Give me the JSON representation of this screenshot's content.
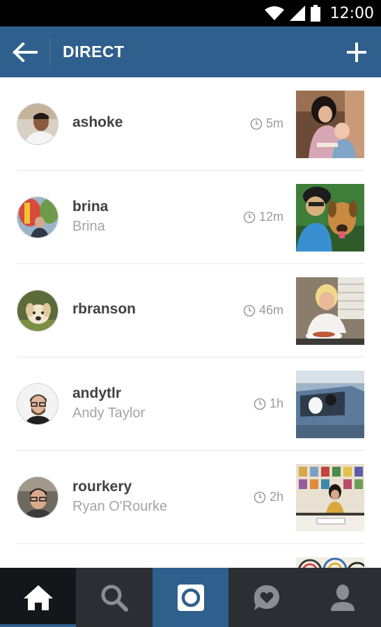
{
  "status_bar": {
    "time": "12:00"
  },
  "header": {
    "title": "DIRECT"
  },
  "threads": [
    {
      "username": "ashoke",
      "fullname": "",
      "time": "5m"
    },
    {
      "username": "brina",
      "fullname": "Brina",
      "time": "12m"
    },
    {
      "username": "rbranson",
      "fullname": "",
      "time": "46m"
    },
    {
      "username": "andytlr",
      "fullname": "Andy Taylor",
      "time": "1h"
    },
    {
      "username": "rourkery",
      "fullname": "Ryan O'Rourke",
      "time": "2h"
    }
  ],
  "bottom_nav": [
    "home",
    "search",
    "camera",
    "activity",
    "profile"
  ],
  "colors": {
    "header": "#2f5f8c",
    "nav_dark": "#2b2f33",
    "nav_active": "#141619"
  }
}
